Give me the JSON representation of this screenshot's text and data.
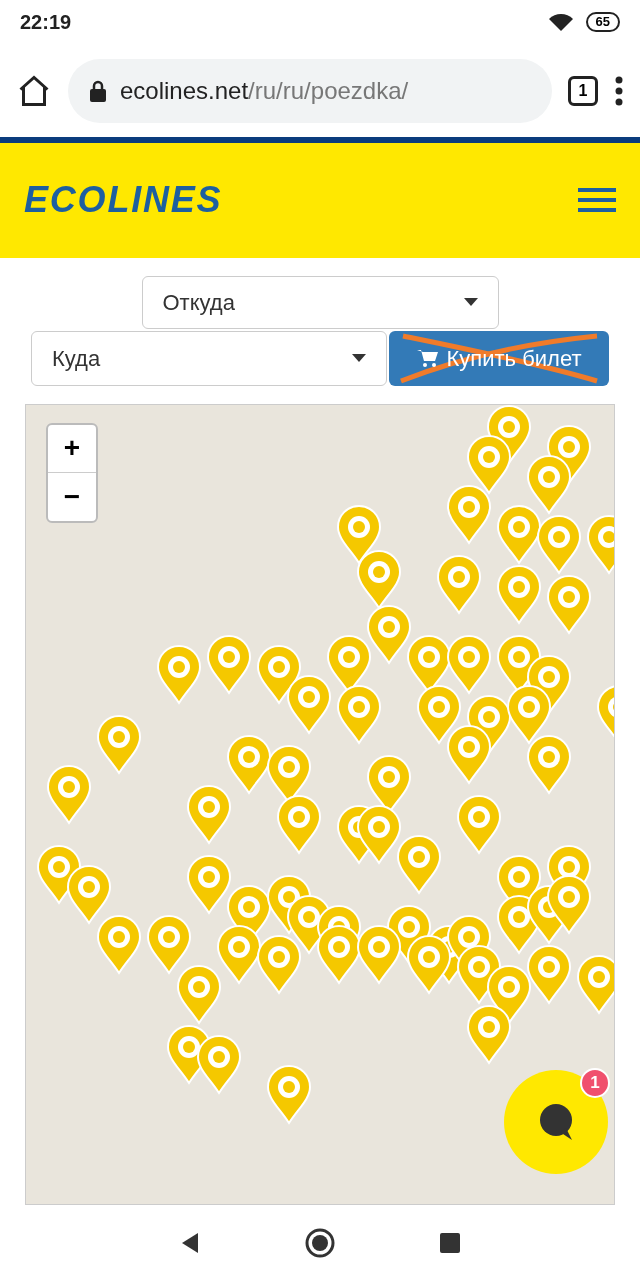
{
  "status_bar": {
    "time": "22:19",
    "battery": "65"
  },
  "browser": {
    "url_domain": "ecolines.net",
    "url_path": "/ru/ru/poezdka/",
    "tab_count": "1"
  },
  "header": {
    "logo": "ECOLINES"
  },
  "search": {
    "from_placeholder": "Откуда",
    "to_placeholder": "Куда",
    "buy_button": "Купить билет"
  },
  "map": {
    "zoom_in": "+",
    "zoom_out": "−"
  },
  "chat": {
    "badge": "1"
  }
}
